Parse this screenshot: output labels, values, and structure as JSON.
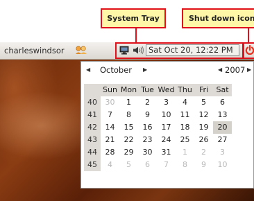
{
  "annotations": {
    "system_tray": "System Tray",
    "shutdown": "Shut down icon"
  },
  "panel": {
    "username": "charleswindsor",
    "icons": [
      "user-switch-icon",
      "network-icon",
      "volume-icon",
      "shutdown-icon"
    ],
    "clock": "Sat Oct 20, 12:22 PM"
  },
  "calendar": {
    "month": "October",
    "year": "2007",
    "weekdays": [
      "Sun",
      "Mon",
      "Tue",
      "Wed",
      "Thu",
      "Fri",
      "Sat"
    ],
    "weeks": [
      {
        "num": "40",
        "days": [
          {
            "d": "30",
            "other": true
          },
          {
            "d": "1"
          },
          {
            "d": "2"
          },
          {
            "d": "3"
          },
          {
            "d": "4"
          },
          {
            "d": "5"
          },
          {
            "d": "6"
          }
        ]
      },
      {
        "num": "41",
        "days": [
          {
            "d": "7"
          },
          {
            "d": "8"
          },
          {
            "d": "9"
          },
          {
            "d": "10"
          },
          {
            "d": "11"
          },
          {
            "d": "12"
          },
          {
            "d": "13"
          }
        ]
      },
      {
        "num": "42",
        "days": [
          {
            "d": "14"
          },
          {
            "d": "15"
          },
          {
            "d": "16"
          },
          {
            "d": "17"
          },
          {
            "d": "18"
          },
          {
            "d": "19"
          },
          {
            "d": "20",
            "today": true
          }
        ]
      },
      {
        "num": "43",
        "days": [
          {
            "d": "21"
          },
          {
            "d": "22"
          },
          {
            "d": "23"
          },
          {
            "d": "24"
          },
          {
            "d": "25"
          },
          {
            "d": "26"
          },
          {
            "d": "27"
          }
        ]
      },
      {
        "num": "44",
        "days": [
          {
            "d": "28"
          },
          {
            "d": "29"
          },
          {
            "d": "30"
          },
          {
            "d": "31"
          },
          {
            "d": "1",
            "other": true
          },
          {
            "d": "2",
            "other": true
          },
          {
            "d": "3",
            "other": true
          }
        ]
      },
      {
        "num": "45",
        "days": [
          {
            "d": "4",
            "other": true
          },
          {
            "d": "5",
            "other": true
          },
          {
            "d": "6",
            "other": true
          },
          {
            "d": "7",
            "other": true
          },
          {
            "d": "8",
            "other": true
          },
          {
            "d": "9",
            "other": true
          },
          {
            "d": "10",
            "other": true
          }
        ]
      }
    ]
  },
  "colors": {
    "callout_fill": "#fff7a8",
    "callout_border": "#e0111b",
    "shutdown_red": "#e8321f"
  }
}
